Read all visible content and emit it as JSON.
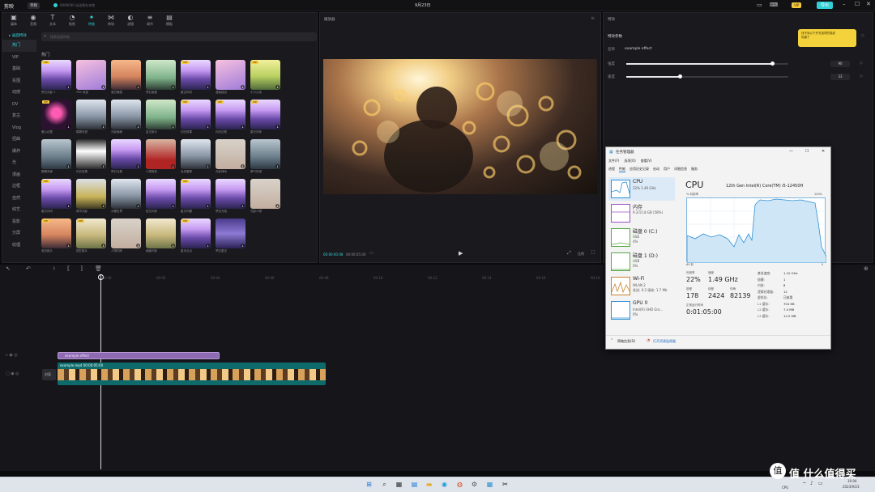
{
  "app": {
    "logo": "剪映",
    "badge": "草稿",
    "title_small": "0000000 自动保存本地",
    "title": "9月23日",
    "vip_badge": "VIP",
    "export_label": "导出"
  },
  "colors": {
    "accent": "#31d0d6",
    "panel": "#1a1a1e",
    "effect_clip": "#8e6ab3",
    "video_clip": "#0f6b6b",
    "note_yellow": "#f4d23c"
  },
  "toolbar": [
    {
      "icon": "media-icon",
      "glyph": "▣",
      "label": "媒体"
    },
    {
      "icon": "audio-icon",
      "glyph": "◉",
      "label": "音频"
    },
    {
      "icon": "text-icon",
      "glyph": "T",
      "label": "文本"
    },
    {
      "icon": "sticker-icon",
      "glyph": "◔",
      "label": "贴纸"
    },
    {
      "icon": "effects-icon",
      "glyph": "✦",
      "label": "特效"
    },
    {
      "icon": "transition-icon",
      "glyph": "⋈",
      "label": "转场"
    },
    {
      "icon": "filter-icon",
      "glyph": "◐",
      "label": "滤镜"
    },
    {
      "icon": "adjust-icon",
      "glyph": "≡",
      "label": "调节"
    },
    {
      "icon": "template-icon",
      "glyph": "▤",
      "label": "模板"
    }
  ],
  "sidebar": {
    "header": "画面特效",
    "items": [
      "热门",
      "VIP",
      "基础",
      "氛围",
      "动感",
      "DV",
      "复古",
      "Vlog",
      "扭曲",
      "爆炸",
      "光",
      "漫画",
      "边框",
      "自然",
      "综艺",
      "投影",
      "分屏",
      "纹理"
    ]
  },
  "search": {
    "placeholder": "搜索画面特效"
  },
  "effects_section": "热门",
  "effects": [
    {
      "label": "梦幻光影 1",
      "style": "t-purple",
      "vip": true
    },
    {
      "label": "Y2K 动漫",
      "style": "t-pink",
      "vip": false
    },
    {
      "label": "落日晚霞",
      "style": "t-sunset",
      "vip": false
    },
    {
      "label": "梦幻画框",
      "style": "t-green",
      "vip": false
    },
    {
      "label": "星空闪闪",
      "style": "t-purple",
      "vip": true
    },
    {
      "label": "漫画描边",
      "style": "t-pink",
      "vip": false
    },
    {
      "label": "小小心动",
      "style": "t-yellow",
      "vip": true
    },
    {
      "label": "爱心边框",
      "style": "t-neon",
      "vip": true
    },
    {
      "label": "模糊光斑",
      "style": "t-forest",
      "vip": false
    },
    {
      "label": "光影画面",
      "style": "t-forest",
      "vip": false
    },
    {
      "label": "复古胶片",
      "style": "t-green",
      "vip": false
    },
    {
      "label": "闪光效果",
      "style": "t-purple",
      "vip": true
    },
    {
      "label": "闪光边框",
      "style": "t-purple",
      "vip": true
    },
    {
      "label": "星光闪烁",
      "style": "t-purple",
      "vip": true
    },
    {
      "label": "模糊背景",
      "style": "t-mist",
      "vip": false
    },
    {
      "label": "闪白效果",
      "style": "t-white",
      "vip": false
    },
    {
      "label": "梦幻光晕",
      "style": "t-purple",
      "vip": false
    },
    {
      "label": "人物剪影",
      "style": "t-red",
      "vip": false
    },
    {
      "label": "自然晨雾",
      "style": "t-forest",
      "vip": false
    },
    {
      "label": "光影律动",
      "style": "t-person",
      "vip": false
    },
    {
      "label": "雾气弥漫",
      "style": "t-mist",
      "vip": false
    },
    {
      "label": "星光闪闪",
      "style": "t-purple",
      "vip": true
    },
    {
      "label": "城市光影",
      "style": "t-car",
      "vip": false
    },
    {
      "label": "冰雪世界",
      "style": "t-forest",
      "vip": false
    },
    {
      "label": "炫光闪烁",
      "style": "t-purple",
      "vip": false
    },
    {
      "label": "星光闪耀",
      "style": "t-purple",
      "vip": true
    },
    {
      "label": "梦幻光线",
      "style": "t-purple",
      "vip": false
    },
    {
      "label": "光影人物",
      "style": "t-person",
      "vip": false
    },
    {
      "label": "老旧胶片",
      "style": "t-sunset",
      "vip": true
    },
    {
      "label": "回忆胶片",
      "style": "t-field",
      "vip": true
    },
    {
      "label": "人物闪烁",
      "style": "t-person",
      "vip": false
    },
    {
      "label": "画面闪烁",
      "style": "t-field",
      "vip": false
    },
    {
      "label": "星光点点",
      "style": "t-purple",
      "vip": true
    },
    {
      "label": "梦幻星空",
      "style": "t-clouds",
      "vip": false
    }
  ],
  "player": {
    "title": "播放器",
    "time_current": "00:00:00:08",
    "time_total": "00:00:05:00",
    "ratio_label": "比例"
  },
  "inspector": {
    "title": "特效",
    "tab": "特效参数",
    "name_label": "名称",
    "name_value": "example effect",
    "params": [
      {
        "label": "强度",
        "value": 90,
        "fill": 0.9
      },
      {
        "label": "速度",
        "value": 33,
        "fill": 0.33
      }
    ],
    "note_text": "找不到以下开关选项的描述\n知道了",
    "note_button": "知道了"
  },
  "task_manager": {
    "title": "任务管理器",
    "menu": [
      "文件(F)",
      "选项(O)",
      "查看(V)"
    ],
    "tabs": [
      "进程",
      "性能",
      "应用历史记录",
      "启动",
      "用户",
      "详细信息",
      "服务"
    ],
    "resources": [
      {
        "name": "CPU",
        "sub1": "22% 1.49 GHz",
        "sub2": "",
        "color": "#2f8fd3"
      },
      {
        "name": "内存",
        "sub1": "9.2/15.8 GB (58%)",
        "sub2": "",
        "color": "#9c4fc7"
      },
      {
        "name": "磁盘 0 (C:)",
        "sub1": "SSD",
        "sub2": "4%",
        "color": "#56a844"
      },
      {
        "name": "磁盘 1 (D:)",
        "sub1": "USB",
        "sub2": "0%",
        "color": "#56a844"
      },
      {
        "name": "Wi-Fi",
        "sub1": "WLAN 2",
        "sub2": "发送: 0.2 接收: 1.7 Mb",
        "color": "#c9822d"
      },
      {
        "name": "GPU 0",
        "sub1": "Intel(R) UHD Gra...",
        "sub2": "0%",
        "color": "#2f8fd3"
      }
    ],
    "cpu_title": "CPU",
    "cpu_model": "12th Gen Intel(R) Core(TM) i5-12450H",
    "graph_label": "% 利用率",
    "graph_max": "100%",
    "graph_time": "60 秒",
    "graph_zero": "0",
    "stats": {
      "util_label": "利用率",
      "util": "22%",
      "speed_label": "速度",
      "speed": "1.49 GHz",
      "proc_label": "进程",
      "proc": "178",
      "thr_label": "线程",
      "thr": "2424",
      "hnd_label": "句柄",
      "hnd": "82139",
      "uptime_label": "正常运行时间",
      "uptime": "0:01:05:00"
    },
    "specs": [
      [
        "基准速度:",
        "1.10 GHz"
      ],
      [
        "插槽:",
        "1"
      ],
      [
        "内核:",
        "8"
      ],
      [
        "逻辑处理器:",
        "12"
      ],
      [
        "虚拟化:",
        "已启用"
      ],
      [
        "L1 缓存:",
        "704 KB"
      ],
      [
        "L2 缓存:",
        "7.0 MB"
      ],
      [
        "L3 缓存:",
        "12.0 MB"
      ]
    ],
    "footer_less": "简略信息(D)",
    "footer_monitor": "打开资源监视器",
    "window_controls": [
      "—",
      "☐",
      "✕"
    ]
  },
  "timeline": {
    "ticks": [
      "00:00",
      "00:02",
      "00:04",
      "00:06",
      "00:08",
      "00:10",
      "00:12",
      "00:14",
      "00:16",
      "00:18",
      "00:20"
    ],
    "effect_clip": "example effect",
    "video_clip": "example.mp4  00:00:05:00",
    "cover_label": "封面"
  },
  "taskbar": {
    "time": "16:04",
    "date": "2023/9/23",
    "cpu_label": "CPU"
  },
  "watermark": "值 什么值得买"
}
